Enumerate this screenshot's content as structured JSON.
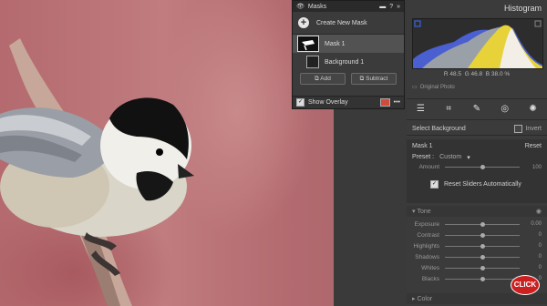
{
  "masks_panel": {
    "title": "Masks",
    "create_label": "Create New Mask",
    "items": [
      {
        "label": "Mask 1"
      },
      {
        "label": "Background 1"
      }
    ],
    "add_label": "Add",
    "subtract_label": "Subtract",
    "show_overlay_label": "Show Overlay",
    "overlay_color": "#d24a3a"
  },
  "histogram": {
    "title": "Histogram",
    "r_label": "R",
    "r_value": "48.5",
    "g_label": "G",
    "g_value": "46.8",
    "b_label": "B",
    "b_value": "38.0 %",
    "original_photo_label": "Original Photo"
  },
  "select_bar": {
    "label": "Select Background",
    "invert_label": "Invert"
  },
  "mask_section": {
    "title": "Mask 1",
    "reset_label": "Reset",
    "preset_label": "Preset :",
    "preset_value": "Custom",
    "amount_label": "Amount",
    "amount_value": "100",
    "reset_sliders_label": "Reset Sliders Automatically"
  },
  "tone": {
    "title": "Tone",
    "sliders": [
      {
        "label": "Exposure",
        "value": "0.00"
      },
      {
        "label": "Contrast",
        "value": "0"
      },
      {
        "label": "Highlights",
        "value": "0"
      },
      {
        "label": "Shadows",
        "value": "0"
      },
      {
        "label": "Whites",
        "value": "0"
      },
      {
        "label": "Blacks",
        "value": "0"
      }
    ]
  },
  "color_section": {
    "title": "Color"
  },
  "badge": {
    "label": "CLICK"
  }
}
